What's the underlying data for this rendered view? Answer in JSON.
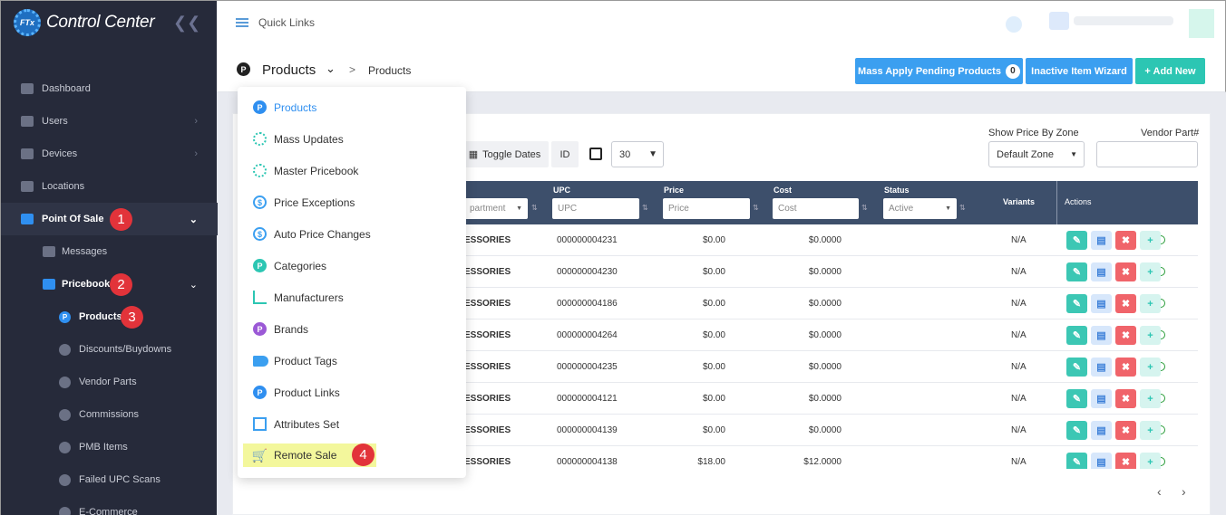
{
  "app": {
    "title": "Control Center",
    "logo_text": "FTx"
  },
  "colors": {
    "accent": "#3b9ff0",
    "teal": "#2cc6b3",
    "sidebar": "#262a3a",
    "badge": "#e2333a",
    "table_header": "#3d4f6b"
  },
  "sidebar": {
    "collapse_glyph": "❮❮",
    "items": [
      {
        "label": "Dashboard",
        "icon": "dashboard-icon"
      },
      {
        "label": "Users",
        "icon": "users-icon",
        "chevron": "›"
      },
      {
        "label": "Devices",
        "icon": "devices-icon",
        "chevron": "›"
      },
      {
        "label": "Locations",
        "icon": "location-pin-icon"
      },
      {
        "label": "Point Of Sale",
        "icon": "cart-icon",
        "chevron": "⌄",
        "active": true,
        "badge": "1"
      },
      {
        "label": "Messages",
        "icon": "messages-icon"
      },
      {
        "label": "Pricebook",
        "icon": "calculator-icon",
        "chevron": "⌄",
        "badge": "2"
      },
      {
        "label": "Products",
        "icon": "products-p-icon",
        "badge": "3"
      },
      {
        "label": "Discounts/Buydowns",
        "icon": "discount-icon"
      },
      {
        "label": "Vendor Parts",
        "icon": "vendor-parts-icon"
      },
      {
        "label": "Commissions",
        "icon": "commissions-icon"
      },
      {
        "label": "PMB Items",
        "icon": "pmb-icon"
      },
      {
        "label": "Failed UPC Scans",
        "icon": "barcode-icon"
      },
      {
        "label": "E-Commerce",
        "icon": "ecommerce-icon"
      }
    ]
  },
  "topbar": {
    "quick_links": "Quick Links"
  },
  "header": {
    "circle": "P",
    "title": "Products",
    "chevron": "⌄",
    "sep": ">",
    "breadcrumb": "Products",
    "mass_apply": "Mass Apply Pending Products",
    "mass_count": "0",
    "inactive": "Inactive Item Wizard",
    "add_new": "+ Add New"
  },
  "dropdown": {
    "items": [
      {
        "label": "Products",
        "icon": "products-p-icon",
        "glyph": "P",
        "selected": true
      },
      {
        "label": "Mass Updates",
        "icon": "mass-updates-icon",
        "glyph": ""
      },
      {
        "label": "Master Pricebook",
        "icon": "master-pricebook-icon",
        "glyph": ""
      },
      {
        "label": "Price Exceptions",
        "icon": "price-exceptions-icon",
        "glyph": "$"
      },
      {
        "label": "Auto Price Changes",
        "icon": "auto-price-icon",
        "glyph": "$"
      },
      {
        "label": "Categories",
        "icon": "categories-p-icon",
        "glyph": "P"
      },
      {
        "label": "Manufacturers",
        "icon": "manufacturers-icon",
        "glyph": ""
      },
      {
        "label": "Brands",
        "icon": "brands-p-icon",
        "glyph": "P"
      },
      {
        "label": "Product Tags",
        "icon": "tag-icon",
        "glyph": ""
      },
      {
        "label": "Product Links",
        "icon": "product-links-p-icon",
        "glyph": "P"
      },
      {
        "label": "Attributes Set",
        "icon": "attributes-icon",
        "glyph": ""
      },
      {
        "label": "Remote Sale",
        "icon": "remote-sale-cart-icon",
        "glyph": "🛒",
        "badge": "4"
      }
    ]
  },
  "toolbar": {
    "toggle_dates": "Toggle Dates",
    "id": "ID",
    "page_size": "30",
    "zone_label": "Show Price By Zone",
    "zone_value": "Default Zone",
    "vendor_label": "Vendor Part#"
  },
  "table": {
    "dept_placeholder": "partment",
    "headers": {
      "upc": "UPC",
      "price": "Price",
      "cost": "Cost",
      "status": "Status",
      "variants": "Variants",
      "actions": "Actions"
    },
    "placeholders": {
      "upc": "UPC",
      "price": "Price",
      "cost": "Cost",
      "status": "Active"
    },
    "rows": [
      {
        "dept": "ESSORIES",
        "upc": "000000004231",
        "price": "$0.00",
        "cost": "$0.0000",
        "variants": "N/A"
      },
      {
        "dept": "ESSORIES",
        "upc": "000000004230",
        "price": "$0.00",
        "cost": "$0.0000",
        "variants": "N/A"
      },
      {
        "dept": "ESSORIES",
        "upc": "000000004186",
        "price": "$0.00",
        "cost": "$0.0000",
        "variants": "N/A"
      },
      {
        "dept": "ESSORIES",
        "upc": "000000004264",
        "price": "$0.00",
        "cost": "$0.0000",
        "variants": "N/A"
      },
      {
        "dept": "ESSORIES",
        "upc": "000000004235",
        "price": "$0.00",
        "cost": "$0.0000",
        "variants": "N/A"
      },
      {
        "dept": "ESSORIES",
        "upc": "000000004121",
        "price": "$0.00",
        "cost": "$0.0000",
        "variants": "N/A"
      },
      {
        "dept": "ESSORIES",
        "upc": "000000004139",
        "price": "$0.00",
        "cost": "$0.0000",
        "variants": "N/A"
      },
      {
        "dept": "ESSORIES",
        "upc": "000000004138",
        "price": "$18.00",
        "cost": "$12.0000",
        "variants": "N/A"
      }
    ],
    "action_glyphs": {
      "edit": "✎",
      "doc": "▤",
      "delete": "✖",
      "add": "+"
    }
  },
  "pager": {
    "prev": "‹",
    "next": "›"
  }
}
